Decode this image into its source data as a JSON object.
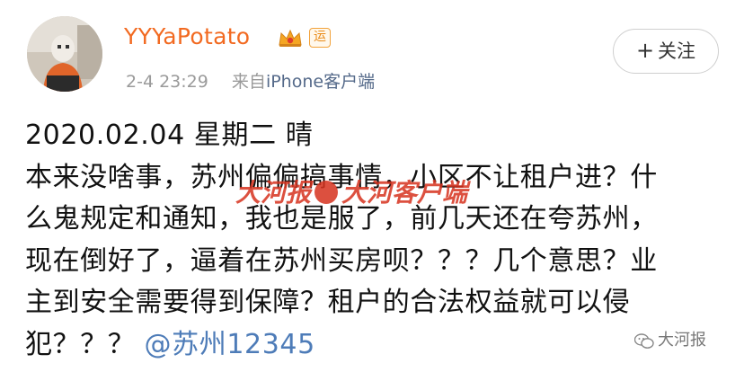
{
  "profile": {
    "username": "YYYaPotato",
    "badge_yun": "运",
    "timestamp": "2-4 23:29",
    "source_prefix": "来自",
    "source_client": "iPhone客户端",
    "follow_label": "关注",
    "follow_plus": "+"
  },
  "post": {
    "lines": [
      "2020.02.04 星期二 晴",
      "本来没啥事，苏州偏偏搞事情，小区不让租户进？什",
      "么鬼规定和通知，我也是服了，前几天还在夸苏州，",
      "现在倒好了，逼着在苏州买房呗？？？几个意思？业",
      "主到安全需要得到保障？租户的合法权益就可以侵",
      "犯？？？"
    ],
    "mention": "@苏州12345"
  },
  "watermark": {
    "left_text": "大河报",
    "right_text": "大河客户端"
  },
  "wechat_mark": {
    "text": "大河报",
    "icon": "wechat-icon"
  },
  "colors": {
    "username": "#f26a21",
    "mention": "#4e7cb8",
    "watermark": "#d7321e",
    "meta": "#9a9a9a"
  }
}
